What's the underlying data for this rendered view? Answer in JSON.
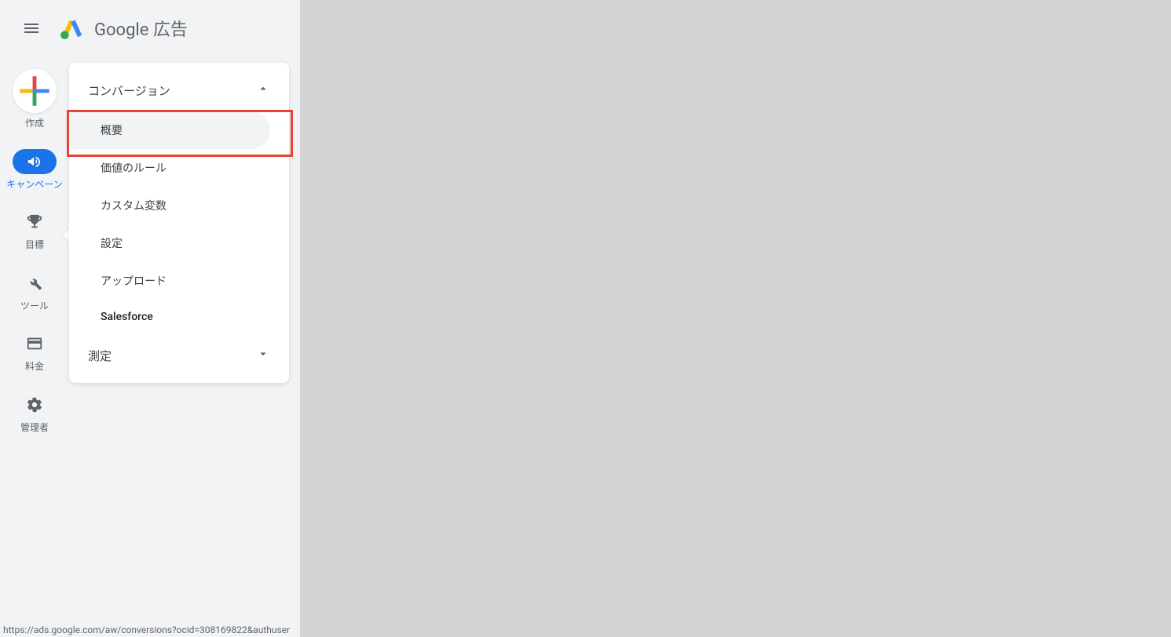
{
  "header": {
    "product_name": "Google 広告"
  },
  "rail": {
    "create": "作成",
    "campaigns": "キャンペーン",
    "goals": "目標",
    "tools": "ツール",
    "billing": "料金",
    "admin": "管理者"
  },
  "submenu": {
    "section_conversions": "コンバージョン",
    "items": {
      "overview": "概要",
      "value_rules": "価値のルール",
      "custom_vars": "カスタム変数",
      "settings": "設定",
      "upload": "アップロード",
      "salesforce": "Salesforce"
    },
    "section_measurement": "測定"
  },
  "status_url": "https://ads.google.com/aw/conversions?ocid=308169822&authuser"
}
